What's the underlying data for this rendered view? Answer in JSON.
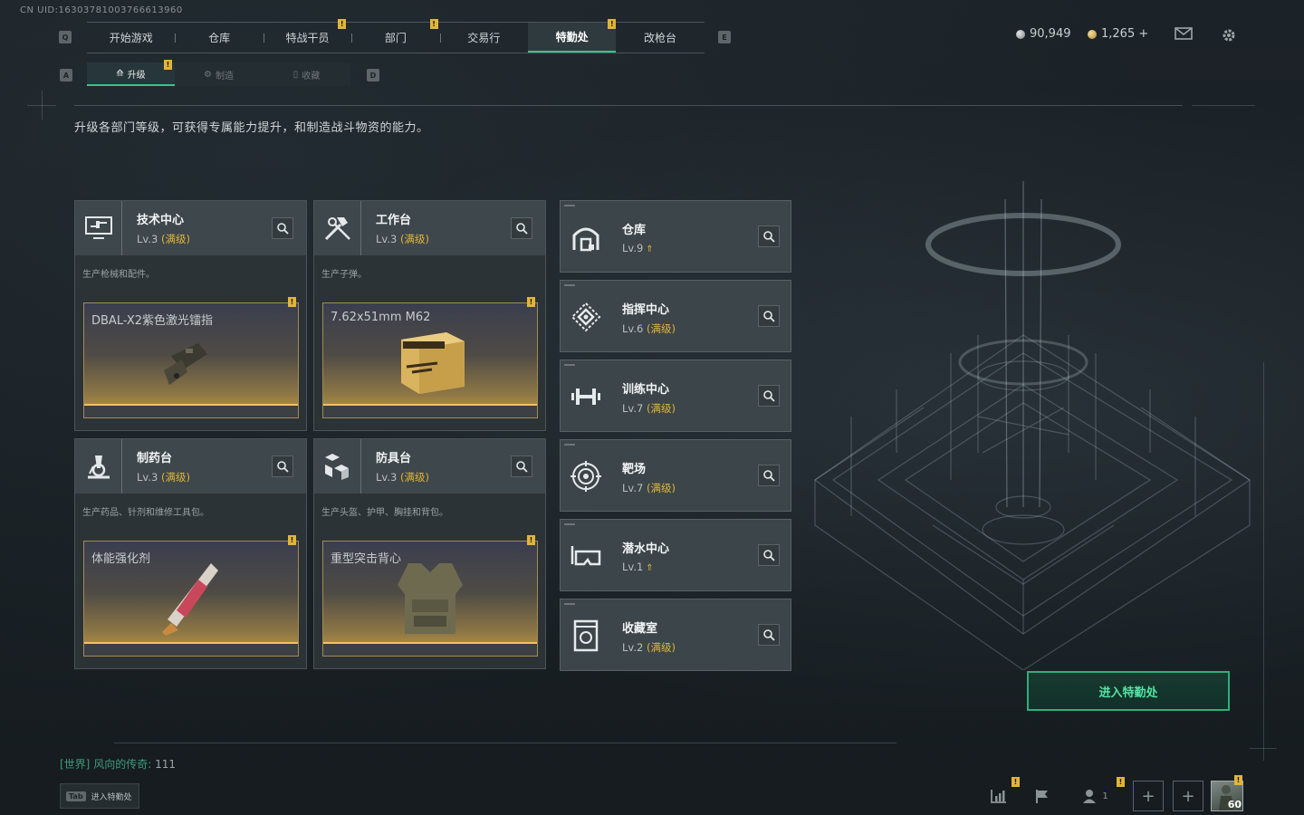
{
  "uid": "CN UID:16303781003766613960",
  "nav": {
    "left_key": "Q",
    "right_key": "E",
    "tabs": [
      {
        "label": "开始游戏",
        "alert": false,
        "active": false
      },
      {
        "label": "仓库",
        "alert": false,
        "active": false
      },
      {
        "label": "特战干员",
        "alert": true,
        "active": false
      },
      {
        "label": "部门",
        "alert": false,
        "active": false
      },
      {
        "label": "交易行",
        "alert": true,
        "active": false
      },
      {
        "label": "特勤处",
        "alert": true,
        "active": true
      },
      {
        "label": "改枪台",
        "alert": false,
        "active": false
      }
    ]
  },
  "currency": {
    "silver": "90,949",
    "gold": "1,265 +"
  },
  "subnav": {
    "left_key": "A",
    "right_key": "D",
    "tabs": [
      {
        "label": "升级",
        "active": true,
        "alert": true
      },
      {
        "label": "制造",
        "active": false,
        "alert": false
      },
      {
        "label": "收藏",
        "active": false,
        "alert": false
      }
    ]
  },
  "description": "升级各部门等级，可获得专属能力提升，和制造战斗物资的能力。",
  "big_cards": [
    {
      "title": "技术中心",
      "level": "Lv.3",
      "max": "(满级)",
      "sub": "生产枪械和配件。",
      "product": "DBAL-X2紫色激光镭指",
      "icon": "computer-icon"
    },
    {
      "title": "工作台",
      "level": "Lv.3",
      "max": "(满级)",
      "sub": "生产子弹。",
      "product": "7.62x51mm M62",
      "icon": "tools-icon"
    },
    {
      "title": "制药台",
      "level": "Lv.3",
      "max": "(满级)",
      "sub": "生产药品、针剂和维修工具包。",
      "product": "体能强化剂",
      "icon": "microscope-icon"
    },
    {
      "title": "防具台",
      "level": "Lv.3",
      "max": "(满级)",
      "sub": "生产头盔、护甲、胸挂和背包。",
      "product": "重型突击背心",
      "icon": "blocks-icon"
    }
  ],
  "small_cards": [
    {
      "title": "仓库",
      "level": "Lv.9",
      "max": "",
      "upgrade": true,
      "icon": "warehouse-icon"
    },
    {
      "title": "指挥中心",
      "level": "Lv.6",
      "max": "(满级)",
      "upgrade": false,
      "icon": "command-icon"
    },
    {
      "title": "训练中心",
      "level": "Lv.7",
      "max": "(满级)",
      "upgrade": false,
      "icon": "dumbbell-icon"
    },
    {
      "title": "靶场",
      "level": "Lv.7",
      "max": "(满级)",
      "upgrade": false,
      "icon": "target-icon"
    },
    {
      "title": "潜水中心",
      "level": "Lv.1",
      "max": "",
      "upgrade": true,
      "icon": "diving-mask-icon"
    },
    {
      "title": "收藏室",
      "level": "Lv.2",
      "max": "(满级)",
      "upgrade": false,
      "icon": "collection-icon"
    }
  ],
  "enter_button": "进入特勤处",
  "chat": {
    "channel": "[世界]",
    "name": "风向的传奇:",
    "msg": "111"
  },
  "tab_hint": {
    "key": "Tab",
    "label": "进入特勤处"
  },
  "dock": {
    "friends_count": "1",
    "player_level": "60"
  }
}
